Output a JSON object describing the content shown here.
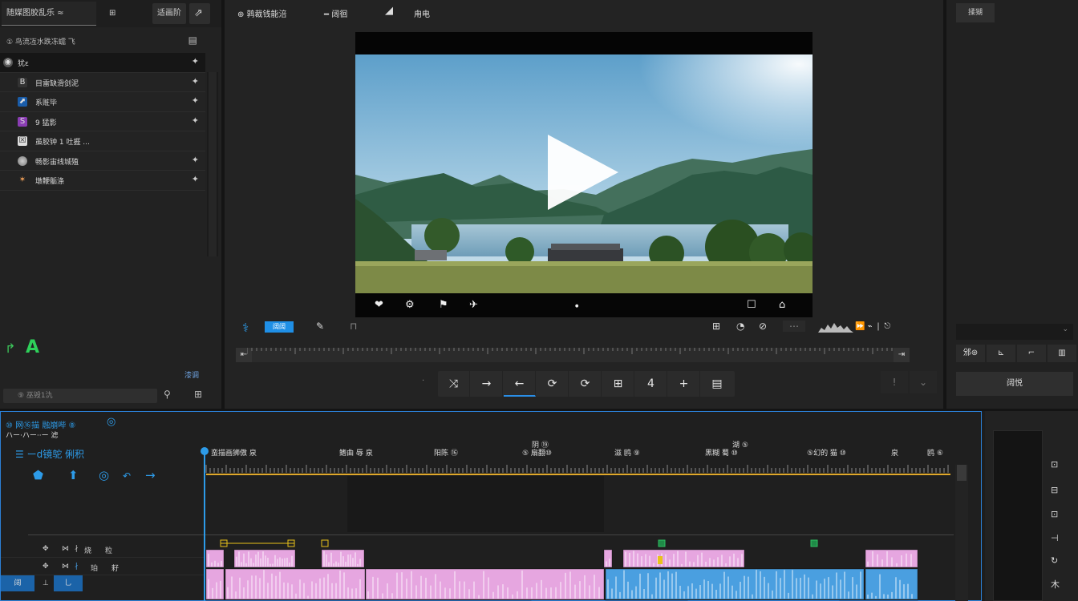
{
  "left_panel": {
    "tabs": [
      "随媒图胶乱乐 ≈",
      "⊞",
      "适画阶",
      "⇗"
    ],
    "search_label": "① 鸟流冱水跌冻蠕 飞",
    "items": [
      {
        "label": "犹ε",
        "icon": "◉"
      },
      {
        "label": "目雷缺滑剑泥",
        "icon": "B"
      },
      {
        "label": "系赃毕",
        "icon": "⬈"
      },
      {
        "label": "9 猛影",
        "icon": "S"
      },
      {
        "label": "虽胶钟 1 吐捱 ...",
        "icon": "☒"
      },
      {
        "label": "畅影宙线城殖",
        "icon": "●"
      },
      {
        "label": "墩鞭骺涤",
        "icon": "✶"
      }
    ],
    "pin_icon": "pin-icon",
    "footer_small_text": "漆调",
    "footer_search": "⑨ 巫毁1氿"
  },
  "center": {
    "tools": [
      "⊕ 鹑裁钱能涪",
      "━ 阔徊",
      "◢",
      "甪电"
    ],
    "video_controls": [
      "❤",
      "⚙",
      "⚑",
      "✈",
      "●",
      "☐",
      "⌂"
    ],
    "toolbar_pill": "阔阔",
    "toolbar_icons": [
      "⚕",
      "⊓",
      "✎",
      "⊞",
      "◔",
      "⊘",
      "⋯",
      "⏩ ⌁ ❘ ⎋"
    ],
    "transport": [
      "⤨",
      "→",
      "←",
      "⟳",
      "⟳",
      "⊞",
      "4",
      "+",
      "▤"
    ],
    "transport_extra": [
      "!",
      "⌄"
    ]
  },
  "right_panel": {
    "tab": "揉猢",
    "buttons": [
      "邠⊛",
      "⊾",
      "⌐",
      "▥"
    ],
    "big_button": "阔悦"
  },
  "timeline": {
    "header_lines": [
      "⑩ 网⑯描 融崩哔 ⑧",
      "ハー·ハー··ー 滤",
      "☰ ーd镜鸵 俐积"
    ],
    "tools": [
      "⬟",
      "⬆",
      "◎",
      "↶",
      "→"
    ],
    "ruler_labels": [
      "蛮描画狮傲 泉",
      "鳍曲 辱 泉",
      "阳陈 ⑯",
      "⑤ 扇翻⑩",
      "滋 鸥 ⑨",
      "黑糊 蜀 ⑩",
      "⑤幻的 猫 ⑩",
      "泉",
      "鸥 ⑥"
    ],
    "ruler_top_labels": [
      "阴 ⑲",
      "湖 ⑤"
    ],
    "track_headers": [
      [
        "✥",
        "⋈",
        "∤",
        "烧",
        "粒"
      ],
      [
        "阔",
        "⊥",
        "乚",
        "珀",
        "耔"
      ]
    ],
    "markers": [
      "⑬",
      "⑬",
      "⑬",
      "⑬",
      "⑬"
    ]
  },
  "bottom_right": {
    "icons": [
      "⊡",
      "⊟",
      "⊡",
      "⊣",
      "↻",
      "木"
    ]
  },
  "colors": {
    "accent": "#2d9be8",
    "clip_pink": "#e6a6e0",
    "clip_blue": "#4a9fe0",
    "clip_green": "#2fbd62",
    "playhead": "#2d9be8",
    "work_area": "#e0a82a"
  }
}
